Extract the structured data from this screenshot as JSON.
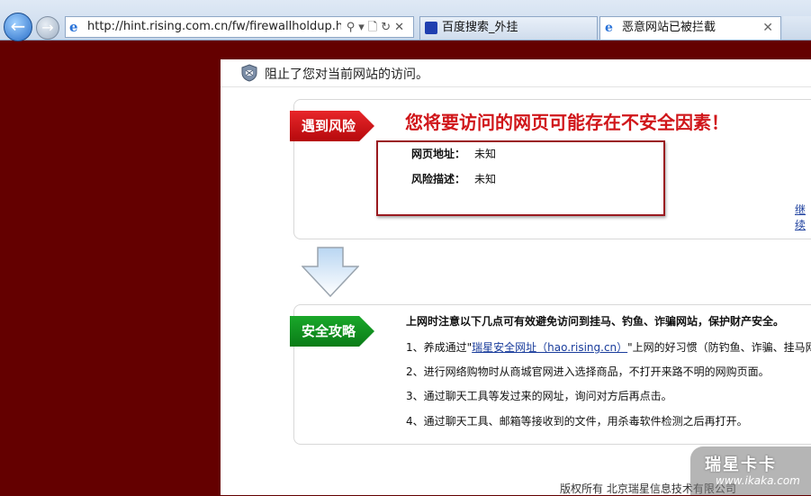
{
  "browser": {
    "url": "http://hint.rising.com.cn/fw/firewallholdup.html?i",
    "tabs": [
      {
        "title": "百度搜索_外挂"
      },
      {
        "title": "恶意网站已被拦截"
      }
    ],
    "close_glyph": "✕",
    "back_glyph": "←",
    "forward_glyph": "→",
    "addr_tools": "⚲▾🗋↻✕"
  },
  "info_bar": {
    "text": "阻止了您对当前网站的访问。"
  },
  "risk": {
    "ribbon": "遇到风险",
    "title": "您将要访问的网页可能存在不安全因素！",
    "url_label": "网页地址：",
    "url_value": "未知",
    "desc_label": "风险描述：",
    "desc_value": "未知",
    "continue_link": "继续"
  },
  "guide": {
    "ribbon": "安全攻略",
    "title": "上网时注意以下几点可有效避免访问到挂马、钓鱼、诈骗网站，保护财产安全。",
    "tip1_prefix": "1、养成通过\"",
    "tip1_link": "瑞星安全网址（hao.rising.cn）",
    "tip1_suffix": "\"上网的好习惯（防钓鱼、诈骗、挂马网站",
    "tip2": "2、进行网络购物时从商城官网进入选择商品，不打开来路不明的网购页面。",
    "tip3": "3、通过聊天工具等发过来的网址，询问对方后再点击。",
    "tip4": "4、通过聊天工具、邮箱等接收到的文件，用杀毒软件检测之后再打开。"
  },
  "footer": {
    "copyright": "版权所有 北京瑞星信息技术有限公司"
  },
  "watermark": {
    "logo": "瑞星卡卡",
    "url": "www.ikaka.com"
  },
  "colors": {
    "page_bg": "#640000",
    "risk_red": "#d0161a",
    "guide_green": "#0f8f1f",
    "link_blue": "#1a3d9c"
  }
}
